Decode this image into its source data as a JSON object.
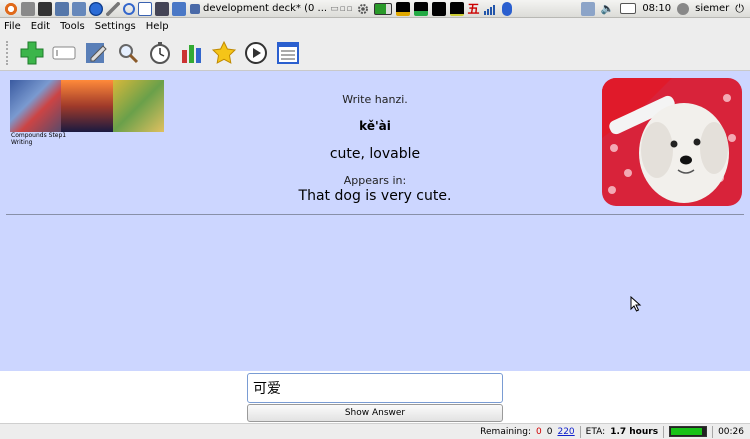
{
  "system_panel": {
    "task_title": "development deck* (0 ...",
    "clock": "08:10",
    "user": "siemer",
    "tray_glyph": "五"
  },
  "menu": {
    "file": "File",
    "edit": "Edit",
    "tools": "Tools",
    "settings": "Settings",
    "help": "Help"
  },
  "toolbar_icons": [
    "add-icon",
    "input-box-icon",
    "edit-icon",
    "search-icon",
    "timer-icon",
    "stats-icon",
    "star-icon",
    "play-icon",
    "list-icon"
  ],
  "card": {
    "thumb_caption_line1": "Compounds  Step1",
    "thumb_caption_line2": "Writing",
    "instruction": "Write hanzi.",
    "pinyin": "kě'ài",
    "meaning": "cute, lovable",
    "appears_label": "Appears in:",
    "sentence": "That dog is very cute."
  },
  "answer": {
    "value": "可爱",
    "show_button": "Show Answer"
  },
  "status": {
    "remaining_label": "Remaining:",
    "new_count": "0",
    "review_count": "0",
    "total_count": "220",
    "eta_label": "ETA:",
    "eta_value": "1.7 hours",
    "progress": 0.92,
    "time": "00:26"
  },
  "colors": {
    "card_bg": "#ccd6ff",
    "remaining_red": "#d00000",
    "link_blue": "#1020cc",
    "progress_green": "#17c217"
  }
}
